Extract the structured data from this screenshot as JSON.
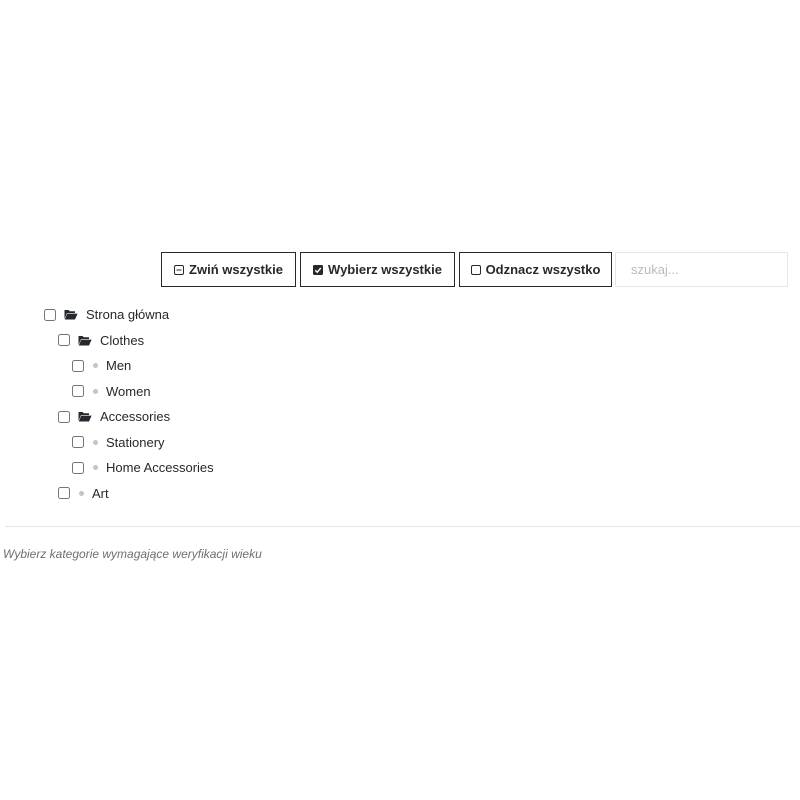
{
  "toolbar": {
    "collapse_label": "Zwiń wszystkie",
    "select_all_label": "Wybierz wszystkie",
    "unselect_all_label": "Odznacz wszystko",
    "search_placeholder": "szukaj..."
  },
  "tree": {
    "root": {
      "label": "Strona główna",
      "icon": "folder-open-icon",
      "checked": false,
      "children": [
        {
          "label": "Clothes",
          "icon": "folder-open-icon",
          "checked": false,
          "children": [
            {
              "label": "Men",
              "icon": "bullet-icon",
              "checked": false
            },
            {
              "label": "Women",
              "icon": "bullet-icon",
              "checked": false
            }
          ]
        },
        {
          "label": "Accessories",
          "icon": "folder-open-icon",
          "checked": false,
          "children": [
            {
              "label": "Stationery",
              "icon": "bullet-icon",
              "checked": false
            },
            {
              "label": "Home Accessories",
              "icon": "bullet-icon",
              "checked": false
            }
          ]
        },
        {
          "label": "Art",
          "icon": "bullet-icon",
          "checked": false
        }
      ]
    }
  },
  "help_text": "Wybierz kategorie wymagające weryfikacji wieku",
  "colors": {
    "text": "#25282c",
    "border": "#25282c",
    "input_border": "#e6e6e6",
    "bullet": "#c4c4c4",
    "help_text": "#6c6f72"
  }
}
